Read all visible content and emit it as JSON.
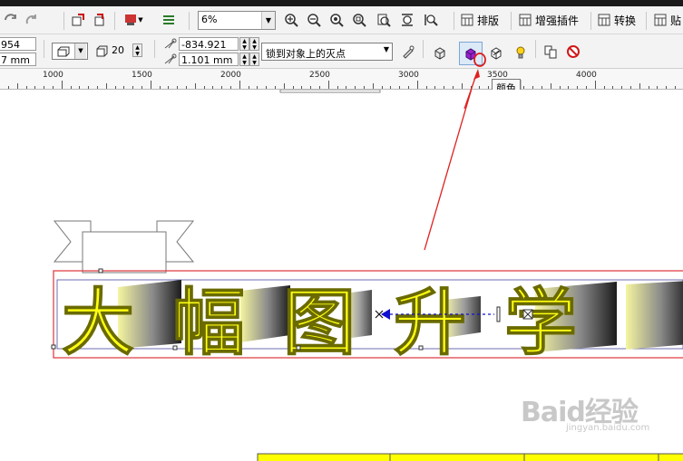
{
  "toolbar": {
    "zoom_value": "6%",
    "menu": [
      {
        "label": "排版"
      },
      {
        "label": "增强插件"
      },
      {
        "label": "转换"
      },
      {
        "label": "贴"
      }
    ]
  },
  "property_bar": {
    "width_partial": "954 mm",
    "height_partial": "7 mm",
    "depth_value": "20",
    "vp_x": "-834.921 mm",
    "vp_y": "1.101 mm",
    "vanishing_point_mode": "锁到对象上的灭点"
  },
  "ruler": {
    "labels": [
      "1000",
      "1500",
      "2000",
      "2500",
      "3000",
      "3500",
      "4000"
    ]
  },
  "tooltip": {
    "text": "颜色"
  },
  "canvas": {
    "extruded_text": "大幅图升学",
    "watermark_main": "Baid经验",
    "watermark_sub": "jingyan.baidu.com"
  },
  "colors": {
    "toolbar_bg": "#f3f3f3",
    "selection_red": "#e0343a",
    "text_yellow": "#ffff14",
    "arrow_red": "#e02020",
    "highlight_circle": "#e01818",
    "table_yellow": "#ffff00"
  }
}
